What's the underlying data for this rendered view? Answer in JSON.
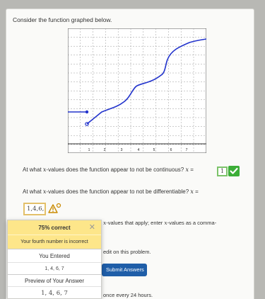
{
  "problem": {
    "prompt": "Consider the function graphed below.",
    "question1": {
      "before": "At what ",
      "var": "x",
      "middle": "-values does the function appear to not be continuous? ",
      "suffix": " =",
      "answer": "1"
    },
    "question2": {
      "before": "At what ",
      "var": "x",
      "middle": "-values does the function appear to not be differentiable? ",
      "suffix": " =",
      "answer": "1,4,6,"
    }
  },
  "graph": {
    "x_tick_labels": [
      "1",
      "2",
      "3",
      "4",
      "5",
      "6",
      "7"
    ],
    "line_color": "#2233cc"
  },
  "popover": {
    "score": "75% correct",
    "close_glyph": "✕",
    "message": "Your fourth number is incorrect",
    "you_entered_label": "You Entered",
    "you_entered_value": "1, 4, 6, 7",
    "preview_label": "Preview of Your Answer",
    "preview_value": "1, 4, 6, 7"
  },
  "background": {
    "hint_var": "x",
    "hint_part1": "-values that apply; enter ",
    "hint_part2": "-values as a comma-",
    "edit_text": "edit on this problem.",
    "submit_label": "Submit Answers",
    "attempts_text": "once every 24 hours."
  },
  "status_colors": {
    "correct": "#3cae38",
    "warning": "#e3c06a",
    "popover_head": "#fde68a",
    "submit": "#1f5ea8"
  },
  "icons": {
    "correct": "check-icon",
    "warning": "warning-icon",
    "close": "close-icon"
  }
}
